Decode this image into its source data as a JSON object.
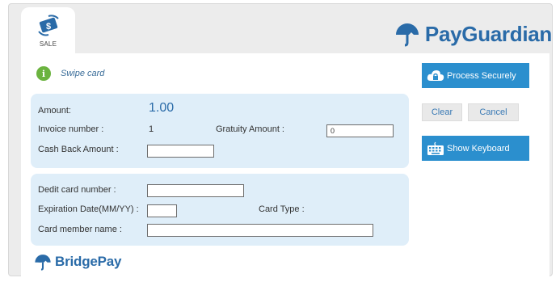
{
  "tab": {
    "label": "SALE",
    "icon": "money-exchange-icon"
  },
  "brand": {
    "name": "PayGuardian",
    "icon": "umbrella-logo-icon"
  },
  "status": {
    "text": "Swipe card",
    "icon": "info-icon",
    "color": "#6bb33f"
  },
  "amount_panel": {
    "amount_label": "Amount:",
    "amount_value": "1.00",
    "invoice_label": "Invoice number :",
    "invoice_value": "1",
    "gratuity_label": "Gratuity Amount :",
    "gratuity_value": "0",
    "cashback_label": "Cash Back Amount :",
    "cashback_value": ""
  },
  "card_panel": {
    "card_number_label": "Dedit card number :",
    "card_number_value": "",
    "expiration_label": "Expiration Date(MM/YY) :",
    "expiration_value": "",
    "card_type_label": "Card Type :",
    "member_name_label": "Card member name :",
    "member_name_value": ""
  },
  "actions": {
    "process": {
      "label": "Process Securely",
      "icon": "cloud-lock-icon"
    },
    "clear": "Clear",
    "cancel": "Cancel",
    "keyboard": {
      "label": "Show Keyboard",
      "icon": "keyboard-icon"
    }
  },
  "footer": {
    "brand": "BridgePay",
    "icon": "umbrella-logo-icon"
  },
  "colors": {
    "accent": "#2b8fce",
    "brand": "#2a6ba8",
    "panel": "#dfeef9"
  }
}
